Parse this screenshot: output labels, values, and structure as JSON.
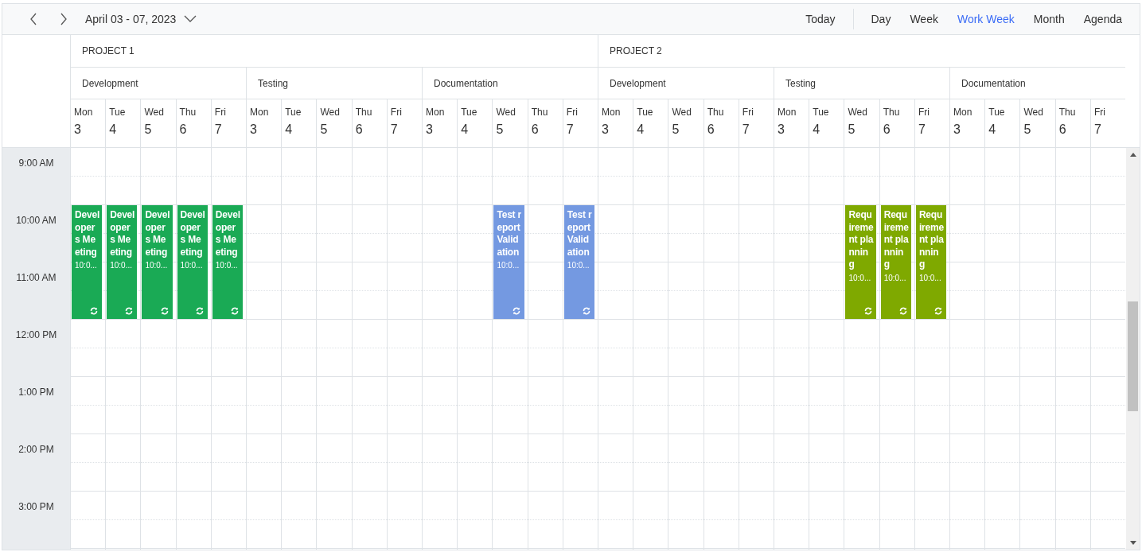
{
  "toolbar": {
    "date_range": "April 03 - 07, 2023",
    "today": "Today",
    "views": [
      {
        "label": "Day",
        "selected": false
      },
      {
        "label": "Week",
        "selected": false
      },
      {
        "label": "Work Week",
        "selected": true
      },
      {
        "label": "Month",
        "selected": false
      },
      {
        "label": "Agenda",
        "selected": false
      }
    ]
  },
  "time_slots": [
    "9:00 AM",
    "10:00 AM",
    "11:00 AM",
    "12:00 PM",
    "1:00 PM",
    "2:00 PM",
    "3:00 PM"
  ],
  "projects": [
    {
      "name": "PROJECT 1",
      "resources": [
        {
          "name": "Development",
          "days": [
            {
              "weekday": "Mon",
              "date": "3",
              "events": [
                {
                  "title": "Developers Meeting",
                  "time": "10:0...",
                  "color": "#1aaa55",
                  "recurring": true
                }
              ]
            },
            {
              "weekday": "Tue",
              "date": "4",
              "events": [
                {
                  "title": "Developers Meeting",
                  "time": "10:0...",
                  "color": "#1aaa55",
                  "recurring": true
                }
              ]
            },
            {
              "weekday": "Wed",
              "date": "5",
              "events": [
                {
                  "title": "Developers Meeting",
                  "time": "10:0...",
                  "color": "#1aaa55",
                  "recurring": true
                }
              ]
            },
            {
              "weekday": "Thu",
              "date": "6",
              "events": [
                {
                  "title": "Developers Meeting",
                  "time": "10:0...",
                  "color": "#1aaa55",
                  "recurring": true
                }
              ]
            },
            {
              "weekday": "Fri",
              "date": "7",
              "events": [
                {
                  "title": "Developers Meeting",
                  "time": "10:0...",
                  "color": "#1aaa55",
                  "recurring": true
                }
              ]
            }
          ]
        },
        {
          "name": "Testing",
          "days": [
            {
              "weekday": "Mon",
              "date": "3"
            },
            {
              "weekday": "Tue",
              "date": "4"
            },
            {
              "weekday": "Wed",
              "date": "5"
            },
            {
              "weekday": "Thu",
              "date": "6"
            },
            {
              "weekday": "Fri",
              "date": "7"
            }
          ]
        },
        {
          "name": "Documentation",
          "days": [
            {
              "weekday": "Mon",
              "date": "3"
            },
            {
              "weekday": "Tue",
              "date": "4"
            },
            {
              "weekday": "Wed",
              "date": "5",
              "events": [
                {
                  "title": "Test report Validation",
                  "time": "10:0...",
                  "color": "#7499e1",
                  "recurring": true
                }
              ]
            },
            {
              "weekday": "Thu",
              "date": "6"
            },
            {
              "weekday": "Fri",
              "date": "7",
              "events": [
                {
                  "title": "Test report Validation",
                  "time": "10:0...",
                  "color": "#7499e1",
                  "recurring": true
                }
              ]
            }
          ]
        }
      ]
    },
    {
      "name": "PROJECT 2",
      "resources": [
        {
          "name": "Development",
          "days": [
            {
              "weekday": "Mon",
              "date": "3"
            },
            {
              "weekday": "Tue",
              "date": "4"
            },
            {
              "weekday": "Wed",
              "date": "5"
            },
            {
              "weekday": "Thu",
              "date": "6"
            },
            {
              "weekday": "Fri",
              "date": "7"
            }
          ]
        },
        {
          "name": "Testing",
          "days": [
            {
              "weekday": "Mon",
              "date": "3"
            },
            {
              "weekday": "Tue",
              "date": "4"
            },
            {
              "weekday": "Wed",
              "date": "5",
              "events": [
                {
                  "title": "Requirement planning",
                  "time": "10:0...",
                  "color": "#7fa900",
                  "recurring": true
                }
              ]
            },
            {
              "weekday": "Thu",
              "date": "6",
              "events": [
                {
                  "title": "Requirement planning",
                  "time": "10:0...",
                  "color": "#7fa900",
                  "recurring": true
                }
              ]
            },
            {
              "weekday": "Fri",
              "date": "7",
              "events": [
                {
                  "title": "Requirement planning",
                  "time": "10:0...",
                  "color": "#7fa900",
                  "recurring": true
                }
              ]
            }
          ]
        },
        {
          "name": "Documentation",
          "days": [
            {
              "weekday": "Mon",
              "date": "3"
            },
            {
              "weekday": "Tue",
              "date": "4"
            },
            {
              "weekday": "Wed",
              "date": "5"
            },
            {
              "weekday": "Thu",
              "date": "6"
            },
            {
              "weekday": "Fri",
              "date": "7"
            }
          ]
        }
      ]
    }
  ]
}
